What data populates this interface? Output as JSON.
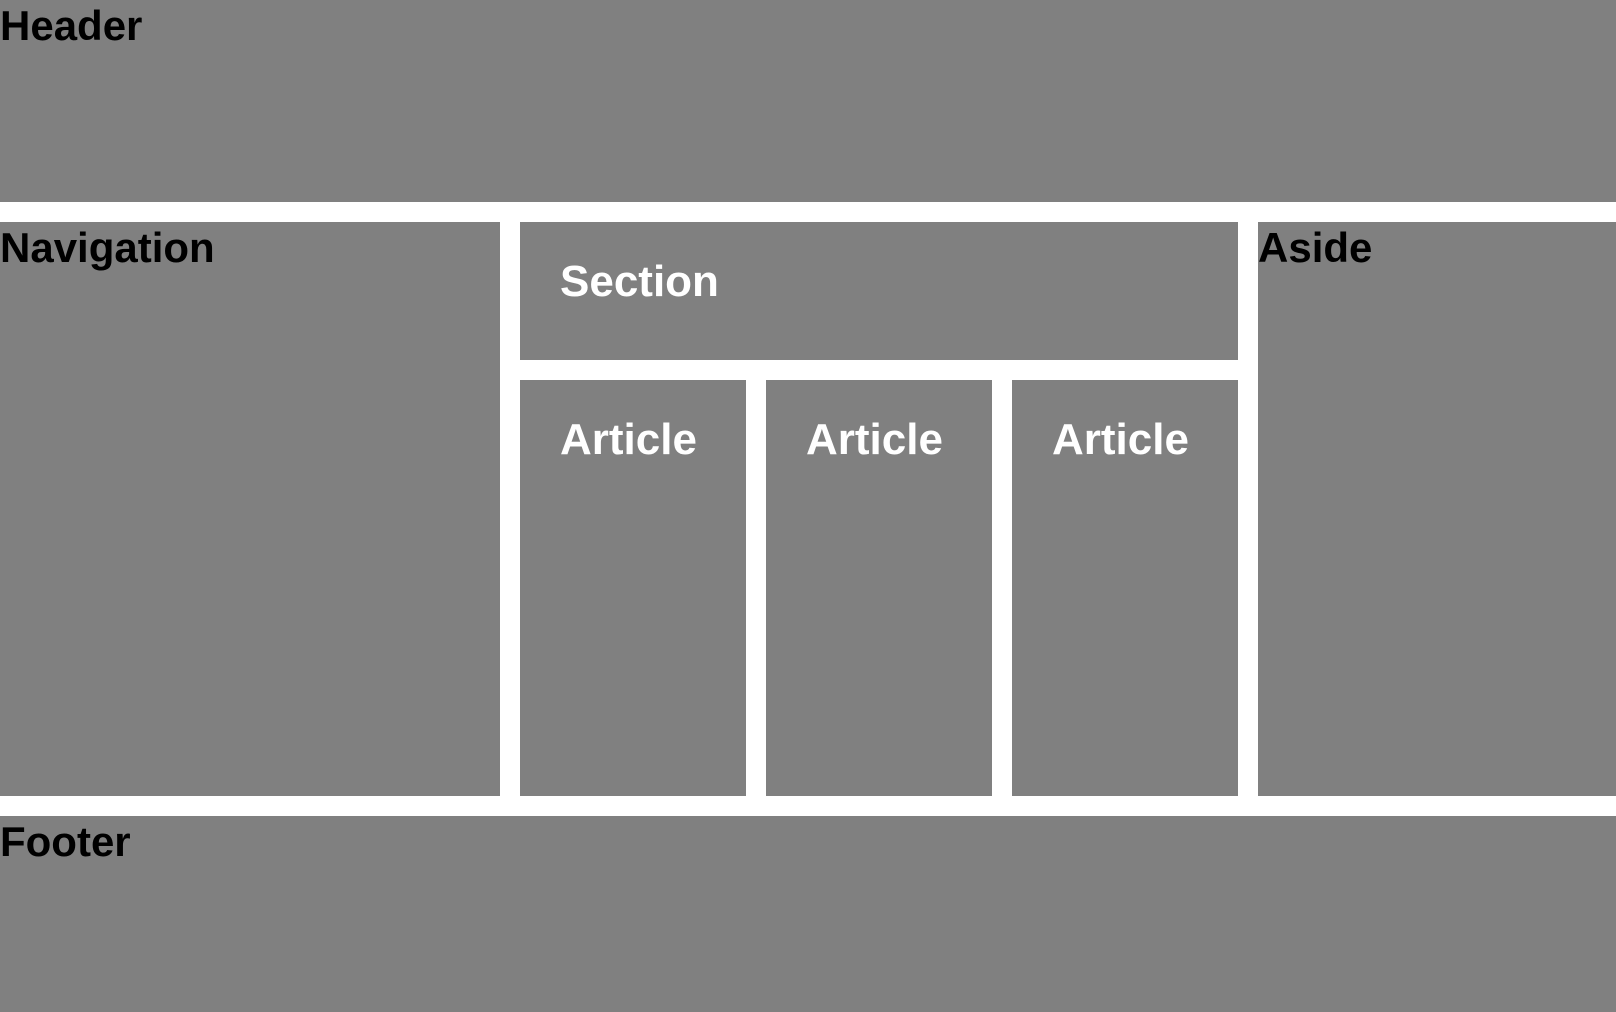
{
  "header": {
    "label": "Header"
  },
  "navigation": {
    "label": "Navigation"
  },
  "section": {
    "label": "Section"
  },
  "articles": [
    {
      "label": "Article"
    },
    {
      "label": "Article"
    },
    {
      "label": "Article"
    }
  ],
  "aside": {
    "label": "Aside"
  },
  "footer": {
    "label": "Footer"
  },
  "colors": {
    "block_background": "#808080",
    "page_background": "#ffffff",
    "dark_text": "#000000",
    "light_text": "#ffffff"
  }
}
